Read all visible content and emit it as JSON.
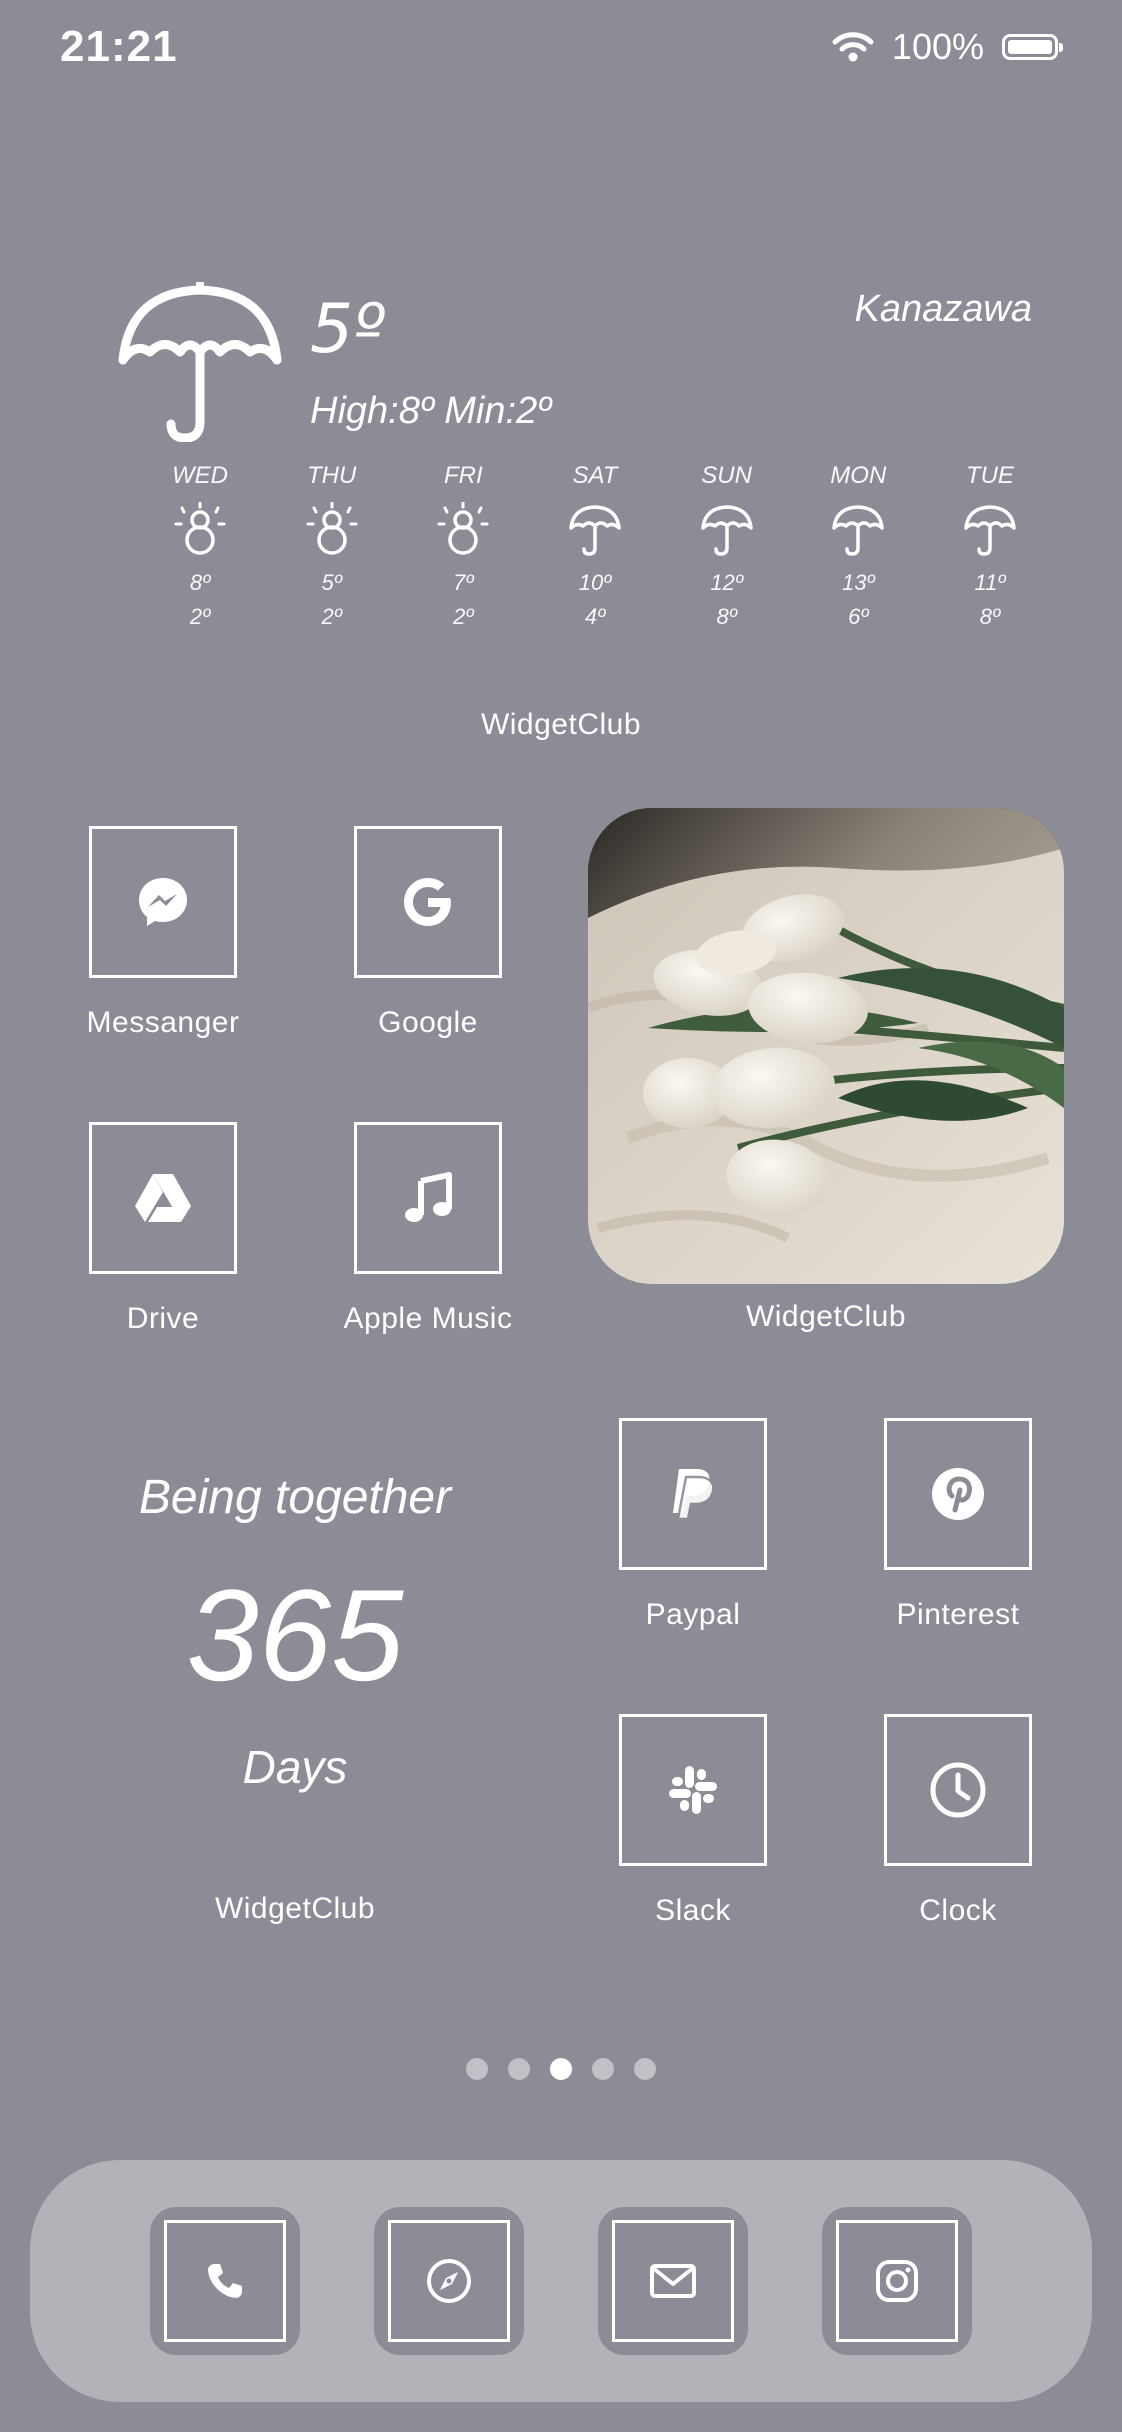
{
  "status_bar": {
    "time": "21:21",
    "battery": "100%"
  },
  "weather": {
    "temp": "5º",
    "high_low": "High:8º Min:2º",
    "city": "Kanazawa",
    "days": [
      {
        "name": "WED",
        "icon": "snowman-icon",
        "high": "8º",
        "low": "2º"
      },
      {
        "name": "THU",
        "icon": "snowman-icon",
        "high": "5º",
        "low": "2º"
      },
      {
        "name": "FRI",
        "icon": "snowman-icon",
        "high": "7º",
        "low": "2º"
      },
      {
        "name": "SAT",
        "icon": "umbrella-icon",
        "high": "10º",
        "low": "4º"
      },
      {
        "name": "SUN",
        "icon": "umbrella-icon",
        "high": "12º",
        "low": "8º"
      },
      {
        "name": "MON",
        "icon": "umbrella-icon",
        "high": "13º",
        "low": "6º"
      },
      {
        "name": "TUE",
        "icon": "umbrella-icon",
        "high": "11º",
        "low": "8º"
      }
    ],
    "caption": "WidgetClub"
  },
  "apps": {
    "messenger": "Messanger",
    "google": "Google",
    "drive": "Drive",
    "apple_music": "Apple Music",
    "paypal": "Paypal",
    "pinterest": "Pinterest",
    "slack": "Slack",
    "clock": "Clock"
  },
  "photo_widget": {
    "caption": "WidgetClub"
  },
  "countdown": {
    "top": "Being together",
    "number": "365",
    "unit": "Days",
    "caption": "WidgetClub"
  },
  "page_dots": {
    "count": 5,
    "active_index": 2
  },
  "dock": [
    "phone-icon",
    "compass-icon",
    "mail-icon",
    "instagram-icon"
  ],
  "colors": {
    "background": "#8c8c97",
    "dock": "#b2b2b9",
    "foreground": "#ffffff"
  }
}
